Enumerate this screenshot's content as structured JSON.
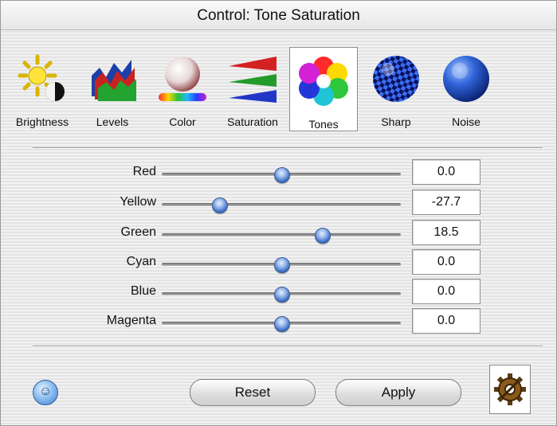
{
  "window": {
    "title": "Control: Tone Saturation"
  },
  "toolbar": {
    "items": [
      {
        "label": "Brightness",
        "icon": "brightness-icon"
      },
      {
        "label": "Levels",
        "icon": "levels-icon"
      },
      {
        "label": "Color",
        "icon": "color-sphere-icon"
      },
      {
        "label": "Saturation",
        "icon": "saturation-icon"
      },
      {
        "label": "Tones",
        "icon": "tones-icon"
      },
      {
        "label": "Sharp",
        "icon": "sharp-icon"
      },
      {
        "label": "Noise",
        "icon": "noise-icon"
      }
    ],
    "selected": "Tones"
  },
  "sliders": [
    {
      "label": "Red",
      "value": "0.0",
      "level": 0.5
    },
    {
      "label": "Yellow",
      "value": "-27.7",
      "level": 0.24
    },
    {
      "label": "Green",
      "value": "18.5",
      "level": 0.67
    },
    {
      "label": "Cyan",
      "value": "0.0",
      "level": 0.5
    },
    {
      "label": "Blue",
      "value": "0.0",
      "level": 0.5
    },
    {
      "label": "Magenta",
      "value": "0.0",
      "level": 0.5
    }
  ],
  "buttons": {
    "reset": "Reset",
    "apply": "Apply"
  },
  "colors": {
    "accent": "#3b6cc6"
  }
}
